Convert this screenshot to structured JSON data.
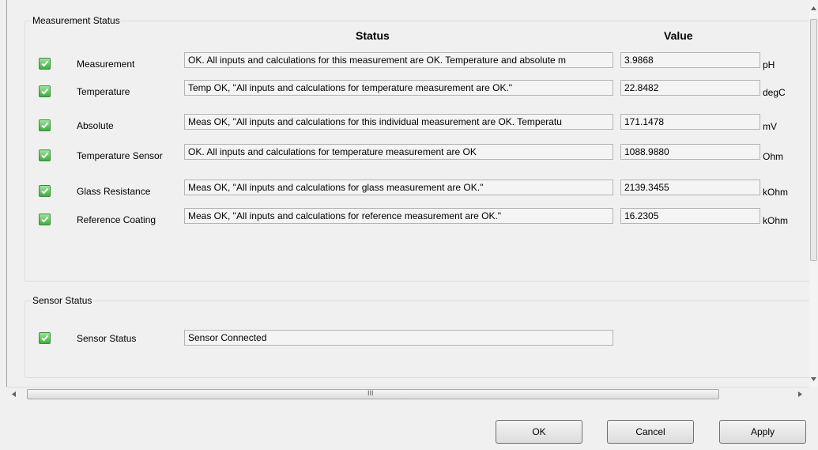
{
  "measurement_group": {
    "title": "Measurement Status",
    "status_header": "Status",
    "value_header": "Value",
    "rows": [
      {
        "label": "Measurement",
        "status": "OK. All inputs and calculations for this measurement are OK. Temperature and absolute m",
        "value": "3.9868",
        "unit": "pH"
      },
      {
        "label": "Temperature",
        "status": "Temp OK, \"All inputs and calculations for temperature measurement are OK.\"",
        "value": "22.8482",
        "unit": "degC"
      },
      {
        "label": "Absolute",
        "status": "Meas OK, \"All inputs and calculations for this individual measurement are OK. Temperatu",
        "value": "171.1478",
        "unit": "mV"
      },
      {
        "label": "Temperature Sensor",
        "status": "OK. All inputs and calculations for temperature measurement are OK",
        "value": "1088.9880",
        "unit": "Ohm"
      },
      {
        "label": "Glass Resistance",
        "status": "Meas OK, \"All inputs and calculations for glass measurement are OK.\"",
        "value": "2139.3455",
        "unit": "kOhm"
      },
      {
        "label": "Reference Coating",
        "status": "Meas OK, \"All inputs and calculations for reference measurement are OK.\"",
        "value": "16.2305",
        "unit": "kOhm"
      }
    ]
  },
  "sensor_group": {
    "title": "Sensor Status",
    "label": "Sensor Status",
    "status": "Sensor Connected"
  },
  "scrollbar": {
    "h_grip": "III"
  },
  "buttons": {
    "ok": "OK",
    "cancel": "Cancel",
    "apply": "Apply"
  },
  "colors": {
    "check_green": "#39b139",
    "background": "#f0f0f0"
  }
}
